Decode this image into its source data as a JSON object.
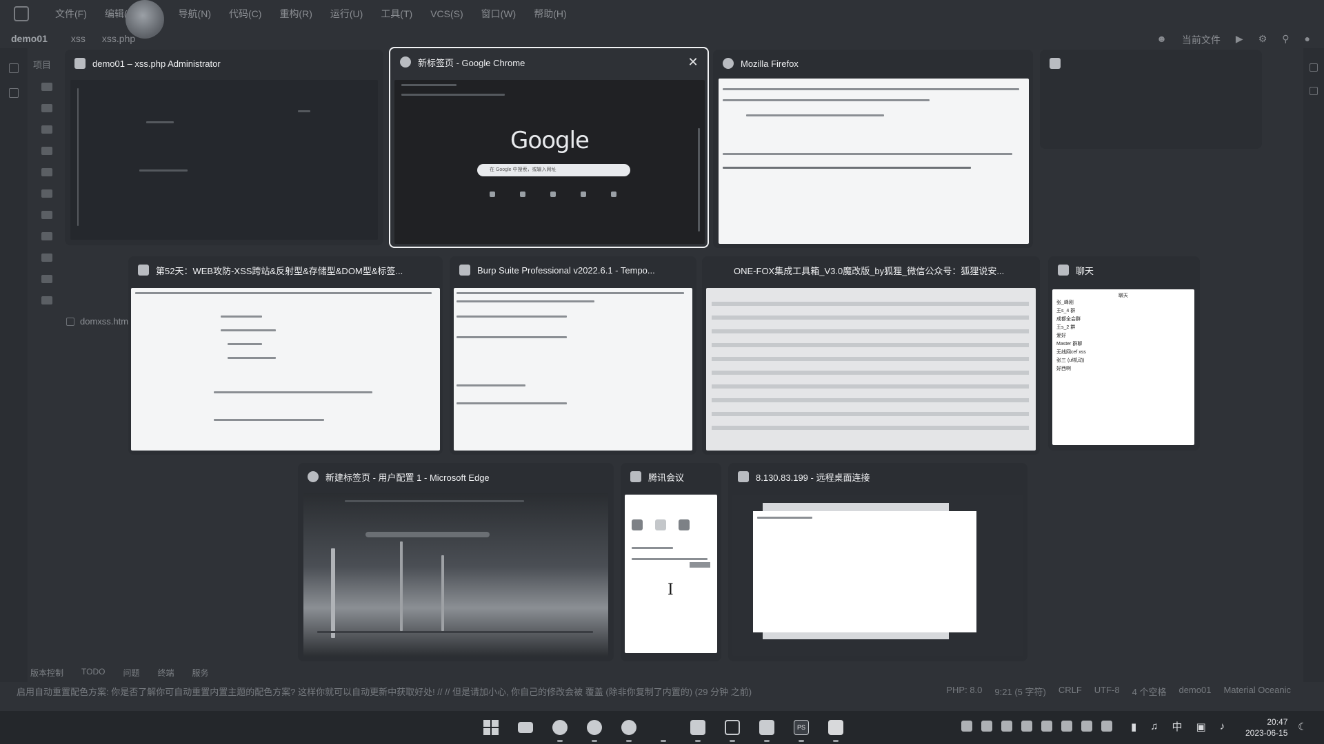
{
  "ide": {
    "menu": [
      "文件(F)",
      "编辑(E)",
      "导航(N)",
      "代码(C)",
      "重构(R)",
      "运行(U)",
      "工具(T)",
      "VCS(S)",
      "窗口(W)",
      "帮助(H)"
    ],
    "breadcrumb": {
      "project": "demo01",
      "folder": "xss",
      "file": "xss.php"
    },
    "toolbar_right_label": "当前文件",
    "project_tab": "项目",
    "tree_file": "domxss.htm",
    "bottom_tools": [
      "版本控制",
      "TODO",
      "问题",
      "终端",
      "服务"
    ],
    "status_message": "启用自动重置配色方案: 你是否了解你可自动重置内置主题的配色方案? 这样你就可以自动更新中获取好处! // // 但是请加小心, 你自己的修改会被 覆盖 (除非你复制了内置的) (29 分钟 之前)",
    "status_right": [
      "PHP: 8.0",
      "9:21 (5 字符)",
      "CRLF",
      "UTF-8",
      "4 个空格",
      "demo01",
      "Material Oceanic"
    ]
  },
  "windows": [
    {
      "id": "phpstorm",
      "title": "demo01 – xss.php Administrator",
      "icon": "phpstorm-icon"
    },
    {
      "id": "chrome",
      "title": "新标签页 - Google Chrome",
      "icon": "chrome-icon",
      "selected": true,
      "logo": "Google",
      "search_placeholder": "在 Google 中搜索，或输入网址"
    },
    {
      "id": "firefox",
      "title": "Mozilla Firefox",
      "icon": "firefox-icon"
    },
    {
      "id": "blank",
      "title": "",
      "icon": "window-icon"
    },
    {
      "id": "typora",
      "title": "第52天：WEB攻防-XSS跨站&反射型&存储型&DOM型&标签...",
      "icon": "typora-icon"
    },
    {
      "id": "burp",
      "title": "Burp Suite Professional v2022.6.1 - Tempo...",
      "icon": "burp-icon"
    },
    {
      "id": "onefox",
      "title": "ONE-FOX集成工具箱_V3.0魔改版_by狐狸_微信公众号：狐狸说安...",
      "icon": ""
    },
    {
      "id": "chat",
      "title": "聊天",
      "icon": "chat-icon",
      "chat_header": "聊天",
      "chat_items": [
        "张_峰刚",
        "王s_4 群",
        "成都全会群",
        "王s_2 群",
        "爱好",
        "Master 群聊",
        "无线网cef xss",
        "张三 (uf机动)",
        "好西啊"
      ]
    },
    {
      "id": "edge",
      "title": "新建标签页 - 用户配置 1 - Microsoft Edge",
      "icon": "edge-icon"
    },
    {
      "id": "tencent",
      "title": "腾讯会议",
      "icon": "meeting-icon"
    },
    {
      "id": "rdp",
      "title": "8.130.83.199 - 远程桌面连接",
      "icon": "remote-desktop-icon"
    }
  ],
  "taskbar": {
    "apps": [
      "start-icon",
      "file-explorer-icon",
      "edge-icon",
      "chrome-icon",
      "firefox-icon",
      "blank",
      "remote-desktop-icon",
      "typora-icon",
      "meeting-icon",
      "phpstorm-icon",
      "burp-icon"
    ],
    "input_method": "中",
    "time": "20:47",
    "date": "2023-06-15"
  }
}
